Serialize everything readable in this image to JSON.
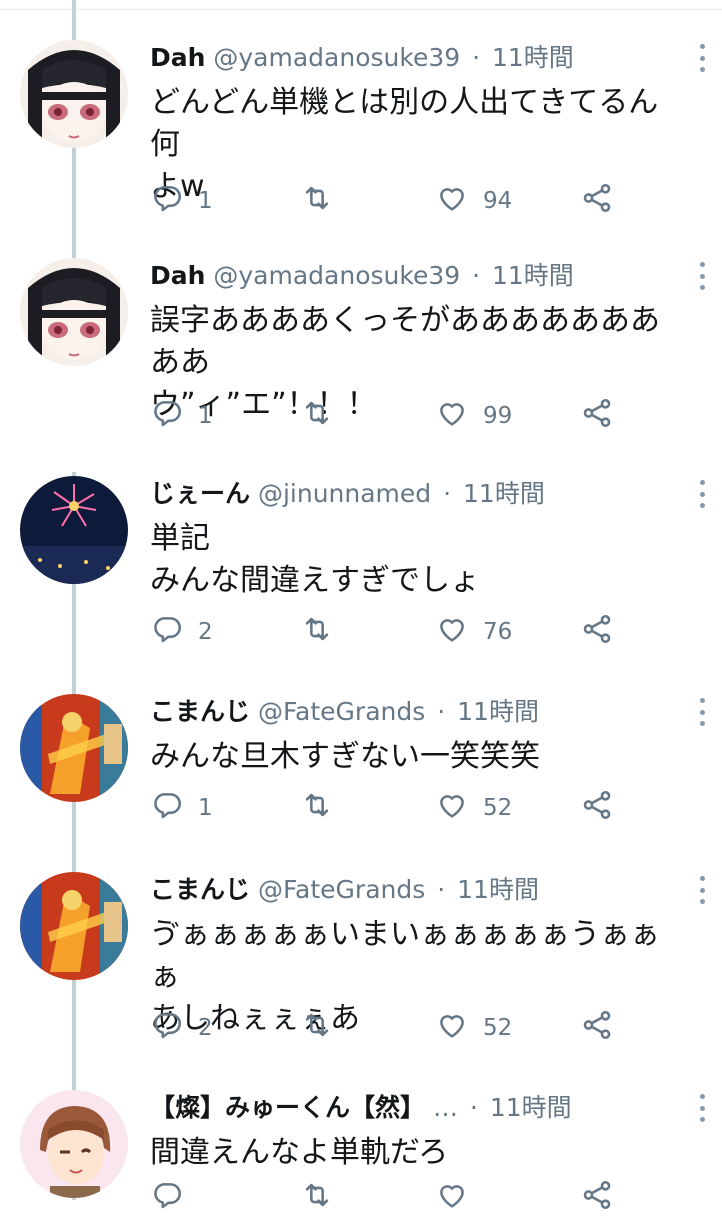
{
  "tweets": [
    {
      "name": "Dah",
      "handle": "@yamadanosuke39",
      "sep": "·",
      "time": "11時間",
      "text": "どんどん単機とは別の人出てきてるん何\nよw",
      "replies": "1",
      "likes": "94",
      "avatar": "dark-hair-girl"
    },
    {
      "name": "Dah",
      "handle": "@yamadanosuke39",
      "sep": "·",
      "time": "11時間",
      "text": "誤字ああああくっそがあああああああああ\nウ”ィ”エ”！！！",
      "replies": "1",
      "likes": "99",
      "avatar": "dark-hair-girl"
    },
    {
      "name": "じぇーん",
      "handle": "@jinunnamed",
      "sep": "·",
      "time": "11時間",
      "text": "単記\nみんな間違えすぎでしょ",
      "replies": "2",
      "likes": "76",
      "avatar": "fireworks"
    },
    {
      "name": "こまんじ",
      "handle": "@FateGrands",
      "sep": "·",
      "time": "11時間",
      "text": "みんな旦木すぎない一笑笑笑",
      "replies": "1",
      "likes": "52",
      "avatar": "game-card"
    },
    {
      "name": "こまんじ",
      "handle": "@FateGrands",
      "sep": "·",
      "time": "11時間",
      "text": "ゔぁぁぁぁぁいまいぁぁぁぁぁうぁぁぁ\nあしねぇぇぇあ",
      "replies": "2",
      "likes": "52",
      "avatar": "game-card"
    },
    {
      "name": "【燦】みゅーくん【然】",
      "handle": "…",
      "sep": "·",
      "time": "11時間",
      "text": "間違えんなよ単軌だろ",
      "replies": "",
      "likes": "",
      "avatar": "anime-character"
    }
  ],
  "colors": {
    "text": "#14171a",
    "muted": "#657786",
    "thread_line": "#c4cfd6"
  },
  "icons": [
    "reply-icon",
    "retweet-icon",
    "like-icon",
    "share-icon",
    "more-icon"
  ]
}
